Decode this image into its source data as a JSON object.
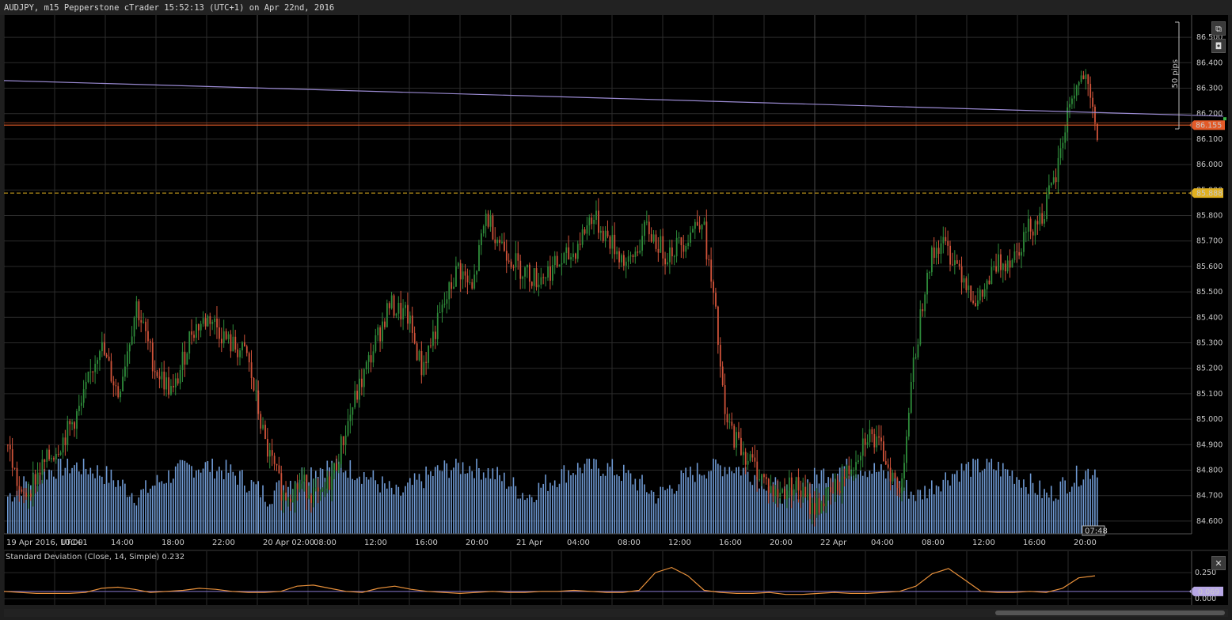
{
  "header": {
    "title": "AUDJPY, m15 Pepperstone cTrader 15:52:13 (UTC+1) on Apr 22nd, 2016"
  },
  "colors": {
    "background": "#000000",
    "grid": "#2b2b2b",
    "bull": "#2e8b3a",
    "bear": "#d0533a",
    "volume": "#6f9ad4",
    "price_line": "#e35a28",
    "level_line": "#e0b020",
    "trend_line": "#9a8ad2",
    "std_line": "#e8903a",
    "std_ref_line": "#8a7ad2"
  },
  "icons": {
    "popout": "external-link-icon",
    "screenshot": "camera-icon",
    "close": "close-icon"
  },
  "chart_data": [
    {
      "type": "candlestick",
      "title": "AUDJPY, m15",
      "y_ticks": [
        "86.500",
        "86.400",
        "86.300",
        "86.200",
        "86.100",
        "86.000",
        "85.900",
        "85.800",
        "85.700",
        "85.600",
        "85.500",
        "85.400",
        "85.300",
        "85.200",
        "85.100",
        "85.000",
        "84.900",
        "84.800",
        "84.700",
        "84.600"
      ],
      "x_ticks": [
        "19 Apr 2016, UTC+1",
        "10:00",
        "14:00",
        "18:00",
        "22:00",
        "20 Apr 02:00",
        "08:00",
        "12:00",
        "16:00",
        "20:00",
        "21 Apr",
        "04:00",
        "08:00",
        "12:00",
        "16:00",
        "20:00",
        "22 Apr",
        "04:00",
        "08:00",
        "12:00",
        "16:00",
        "20:00"
      ],
      "ylim": [
        84.55,
        86.55
      ],
      "labels": {
        "current_price": "86.155",
        "level_price": "85.888",
        "pips_ruler": "50 pips",
        "countdown": "07:48"
      },
      "horizontal_lines": [
        {
          "name": "current price",
          "value": 86.155
        },
        {
          "name": "level",
          "value": 85.888
        }
      ],
      "trend_line": {
        "start": 86.33,
        "end": 86.19
      },
      "price_path": [
        [
          0,
          84.9
        ],
        [
          6,
          84.68
        ],
        [
          14,
          84.8
        ],
        [
          24,
          84.92
        ],
        [
          32,
          85.05
        ],
        [
          40,
          85.3
        ],
        [
          48,
          85.1
        ],
        [
          56,
          85.45
        ],
        [
          64,
          85.2
        ],
        [
          72,
          85.1
        ],
        [
          80,
          85.35
        ],
        [
          88,
          85.4
        ],
        [
          96,
          85.3
        ],
        [
          104,
          85.25
        ],
        [
          112,
          84.9
        ],
        [
          120,
          84.7
        ],
        [
          128,
          84.75
        ],
        [
          136,
          84.68
        ],
        [
          142,
          84.8
        ],
        [
          150,
          85.05
        ],
        [
          158,
          85.25
        ],
        [
          166,
          85.45
        ],
        [
          174,
          85.4
        ],
        [
          180,
          85.2
        ],
        [
          188,
          85.4
        ],
        [
          196,
          85.6
        ],
        [
          202,
          85.5
        ],
        [
          208,
          85.8
        ],
        [
          214,
          85.7
        ],
        [
          222,
          85.6
        ],
        [
          230,
          85.55
        ],
        [
          238,
          85.6
        ],
        [
          246,
          85.65
        ],
        [
          254,
          85.8
        ],
        [
          262,
          85.7
        ],
        [
          270,
          85.6
        ],
        [
          278,
          85.75
        ],
        [
          286,
          85.65
        ],
        [
          294,
          85.7
        ],
        [
          302,
          85.8
        ],
        [
          308,
          85.4
        ],
        [
          312,
          85.0
        ],
        [
          318,
          84.9
        ],
        [
          326,
          84.8
        ],
        [
          334,
          84.7
        ],
        [
          342,
          84.75
        ],
        [
          350,
          84.65
        ],
        [
          358,
          84.7
        ],
        [
          366,
          84.8
        ],
        [
          374,
          84.95
        ],
        [
          382,
          84.85
        ],
        [
          388,
          84.7
        ],
        [
          394,
          85.2
        ],
        [
          400,
          85.6
        ],
        [
          406,
          85.7
        ],
        [
          414,
          85.6
        ],
        [
          422,
          85.45
        ],
        [
          430,
          85.6
        ],
        [
          438,
          85.65
        ],
        [
          444,
          85.75
        ],
        [
          450,
          85.8
        ],
        [
          456,
          85.95
        ],
        [
          462,
          86.25
        ],
        [
          468,
          86.35
        ],
        [
          474,
          86.12
        ]
      ],
      "volume_scale_note": "relative tick volume bars along bottom"
    },
    {
      "type": "line",
      "title": "Standard Deviation (Close, 14, Simple) 0.232",
      "y_ticks": [
        "0.250",
        "0.000"
      ],
      "ylim": [
        0.0,
        0.35
      ],
      "labels": {
        "current_value": "0.069"
      },
      "reference_value": 0.069,
      "values": [
        0.07,
        0.06,
        0.05,
        0.05,
        0.05,
        0.06,
        0.1,
        0.11,
        0.09,
        0.06,
        0.07,
        0.08,
        0.1,
        0.09,
        0.07,
        0.06,
        0.06,
        0.07,
        0.12,
        0.13,
        0.1,
        0.07,
        0.06,
        0.1,
        0.12,
        0.09,
        0.07,
        0.06,
        0.05,
        0.06,
        0.07,
        0.06,
        0.06,
        0.07,
        0.07,
        0.08,
        0.07,
        0.06,
        0.06,
        0.08,
        0.25,
        0.3,
        0.22,
        0.08,
        0.06,
        0.05,
        0.05,
        0.06,
        0.04,
        0.04,
        0.05,
        0.06,
        0.05,
        0.05,
        0.06,
        0.07,
        0.12,
        0.24,
        0.29,
        0.18,
        0.07,
        0.06,
        0.06,
        0.07,
        0.06,
        0.1,
        0.2,
        0.22
      ]
    }
  ]
}
